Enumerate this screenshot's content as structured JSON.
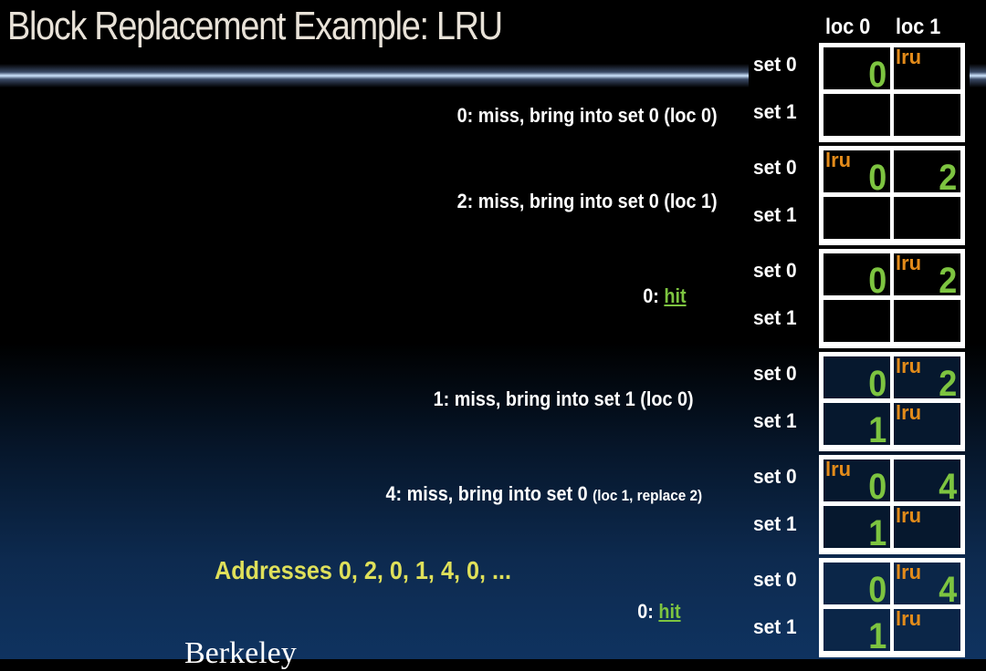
{
  "title": "Block Replacement Example: LRU",
  "column_headers": [
    "loc 0",
    "loc 1"
  ],
  "set_labels": [
    "set 0",
    "set 1"
  ],
  "steps": [
    {
      "address": "0",
      "text": "0: miss, bring into set 0 (loc 0)",
      "extra": ""
    },
    {
      "address": "2",
      "text": "2: miss, bring into set 0 (loc 1)",
      "extra": ""
    },
    {
      "address": "0",
      "prefix": "0: ",
      "hit": "hit"
    },
    {
      "address": "1",
      "text": "1: miss, bring into set 1 (loc 0)",
      "extra": ""
    },
    {
      "address": "4",
      "text": "4: miss, bring into set 0 ",
      "extra": "(loc 1, replace 2)"
    },
    {
      "address": "0",
      "prefix": "0: ",
      "hit": "hit"
    }
  ],
  "addresses_line": "Addresses 0, 2, 0, 1, 4, 0, ...",
  "footer_logo": "Berkeley",
  "lru_marker": "lru",
  "cache_states": [
    {
      "set0": {
        "loc0": "0",
        "loc1": "",
        "lru": "loc1"
      },
      "set1": {
        "loc0": "",
        "loc1": "",
        "lru": ""
      }
    },
    {
      "set0": {
        "loc0": "0",
        "loc1": "2",
        "lru": "loc0"
      },
      "set1": {
        "loc0": "",
        "loc1": "",
        "lru": ""
      }
    },
    {
      "set0": {
        "loc0": "0",
        "loc1": "2",
        "lru": "loc1"
      },
      "set1": {
        "loc0": "",
        "loc1": "",
        "lru": ""
      }
    },
    {
      "set0": {
        "loc0": "0",
        "loc1": "2",
        "lru": "loc1"
      },
      "set1": {
        "loc0": "1",
        "loc1": "",
        "lru": "loc1"
      }
    },
    {
      "set0": {
        "loc0": "0",
        "loc1": "4",
        "lru": "loc0"
      },
      "set1": {
        "loc0": "1",
        "loc1": "",
        "lru": "loc1"
      }
    },
    {
      "set0": {
        "loc0": "0",
        "loc1": "4",
        "lru": "loc1"
      },
      "set1": {
        "loc0": "1",
        "loc1": "",
        "lru": "loc1"
      }
    }
  ],
  "colors": {
    "value_green": "#7dc440",
    "lru_orange": "#e38b1a",
    "addresses_yellow": "#dfe05a",
    "title_color": "#e8e2d8"
  }
}
